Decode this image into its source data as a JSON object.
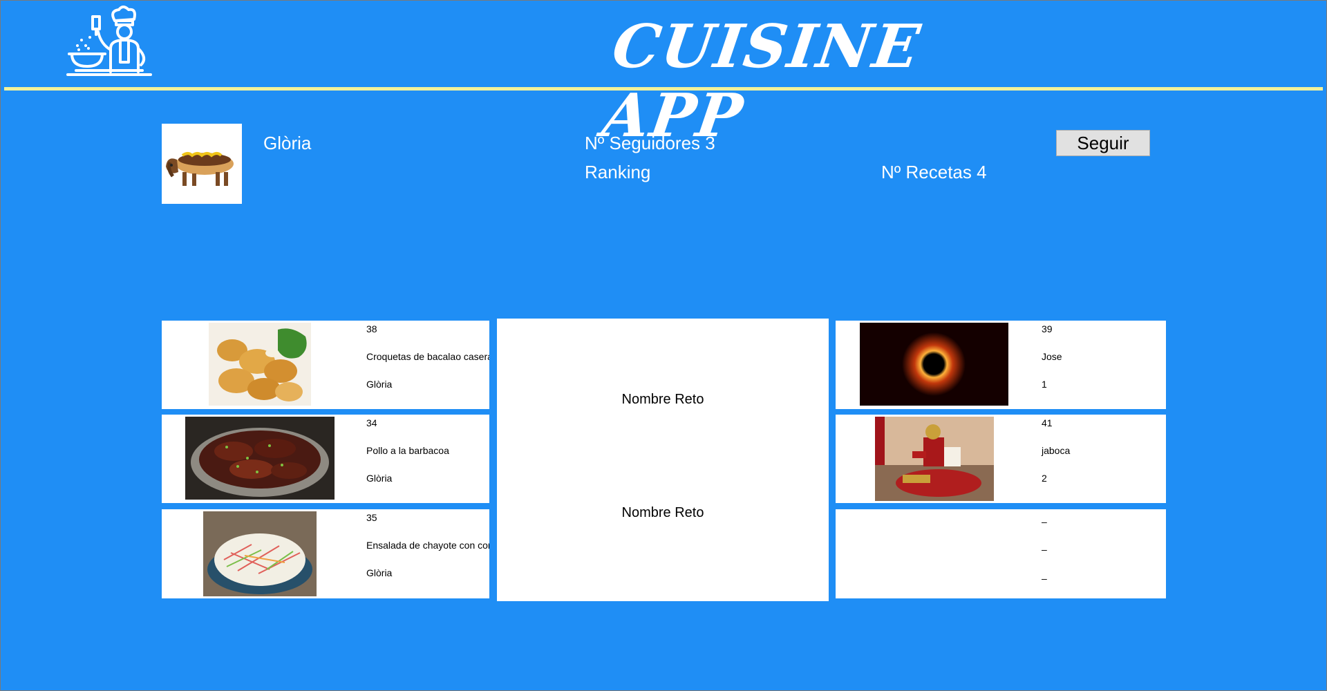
{
  "app": {
    "title": "CUISINE APP"
  },
  "profile": {
    "name": "Glòria",
    "followers_text": "Nº Seguidores 3",
    "ranking_text": "Ranking",
    "recipes_text": "Nº Recetas 4",
    "follow_button": "Seguir"
  },
  "recipes": [
    {
      "id": "38",
      "name": "Croquetas de bacalao caseras",
      "author": "Glòria"
    },
    {
      "id": "34",
      "name": "Pollo a la barbacoa",
      "author": "Glòria"
    },
    {
      "id": "35",
      "name": "Ensalada de chayote con con",
      "author": "Glòria"
    }
  ],
  "challenges": [
    {
      "name": "Nombre Reto"
    },
    {
      "name": "Nombre Reto"
    }
  ],
  "users": [
    {
      "id": "39",
      "name": "Jose",
      "value": "1"
    },
    {
      "id": "41",
      "name": "jaboca",
      "value": "2"
    },
    {
      "id": "–",
      "name": "–",
      "value": "–"
    }
  ],
  "colors": {
    "background": "#1f8ef5",
    "rule": "#f2f29a",
    "card": "#ffffff"
  }
}
